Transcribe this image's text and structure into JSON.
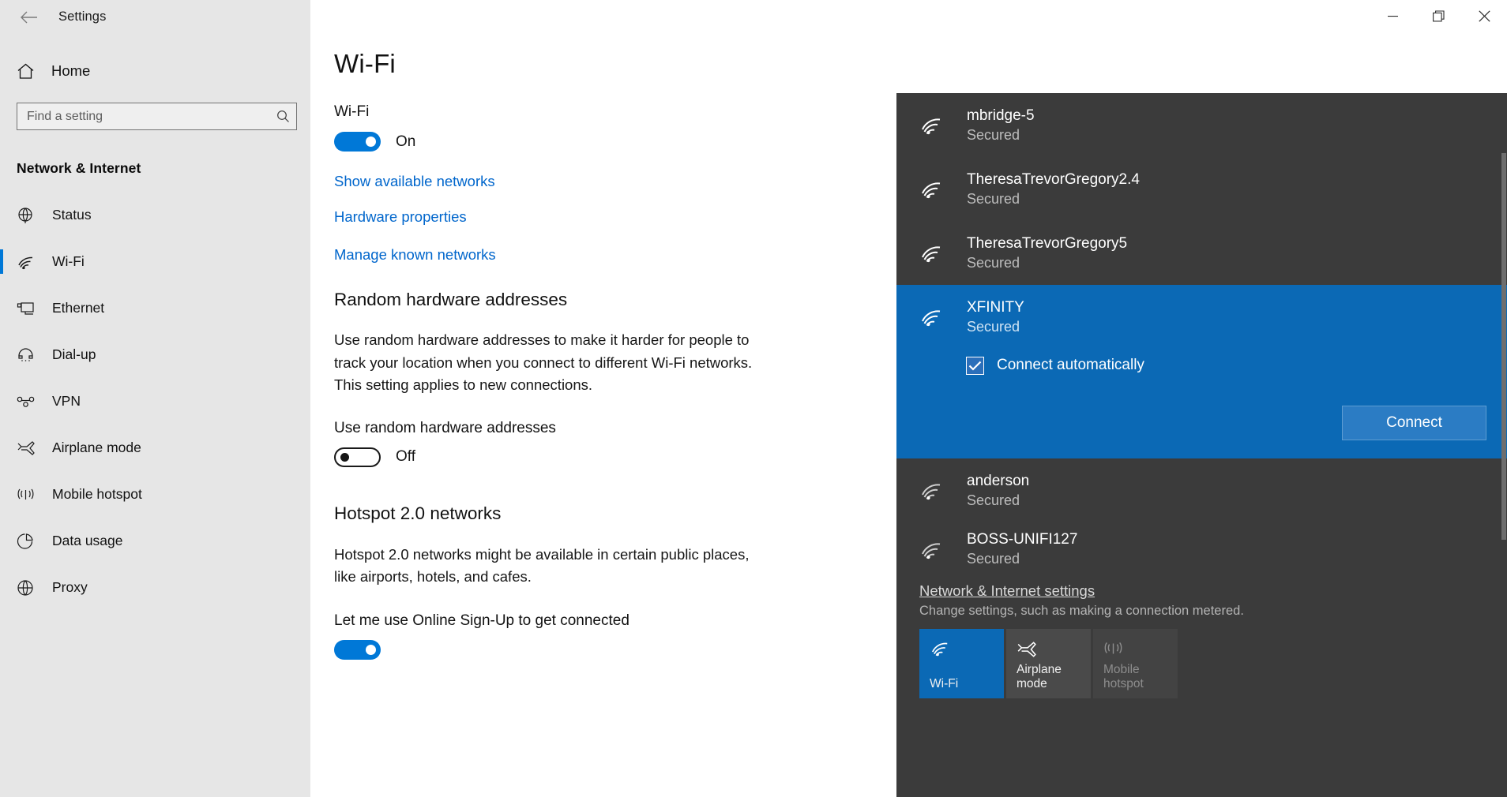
{
  "window": {
    "title": "Settings",
    "back_icon": "back-arrow-icon",
    "minimize_label": "Minimize",
    "restore_label": "Restore",
    "close_label": "Close"
  },
  "sidebar": {
    "home_label": "Home",
    "home_icon": "home-icon",
    "search": {
      "placeholder": "Find a setting",
      "value": "",
      "icon": "search-icon"
    },
    "category": "Network & Internet",
    "items": [
      {
        "label": "Status",
        "icon": "globe-icon",
        "active": false
      },
      {
        "label": "Wi-Fi",
        "icon": "wifi-icon",
        "active": true
      },
      {
        "label": "Ethernet",
        "icon": "ethernet-icon",
        "active": false
      },
      {
        "label": "Dial-up",
        "icon": "dialup-icon",
        "active": false
      },
      {
        "label": "VPN",
        "icon": "vpn-icon",
        "active": false
      },
      {
        "label": "Airplane mode",
        "icon": "airplane-icon",
        "active": false
      },
      {
        "label": "Mobile hotspot",
        "icon": "hotspot-icon",
        "active": false
      },
      {
        "label": "Data usage",
        "icon": "data-usage-icon",
        "active": false
      },
      {
        "label": "Proxy",
        "icon": "proxy-icon",
        "active": false
      }
    ]
  },
  "main": {
    "page_title": "Wi-Fi",
    "wifi_section": {
      "label": "Wi-Fi",
      "toggle_state": "On",
      "toggle_on": true
    },
    "links": [
      "Show available networks",
      "Hardware properties",
      "Manage known networks"
    ],
    "random_hw": {
      "heading": "Random hardware addresses",
      "description": "Use random hardware addresses to make it harder for people to track your location when you connect to different Wi-Fi networks. This setting applies to new connections.",
      "toggle_label": "Use random hardware addresses",
      "toggle_state": "Off",
      "toggle_on": false
    },
    "hotspot": {
      "heading": "Hotspot 2.0 networks",
      "description": "Hotspot 2.0 networks might be available in certain public places, like airports, hotels, and cafes.",
      "toggle_label": "Let me use Online Sign-Up to get connected"
    }
  },
  "flyout": {
    "networks": [
      {
        "name": "mbridge-5",
        "status": "Secured",
        "selected": false
      },
      {
        "name": "TheresaTrevorGregory2.4",
        "status": "Secured",
        "selected": false
      },
      {
        "name": "TheresaTrevorGregory5",
        "status": "Secured",
        "selected": false
      },
      {
        "name": "XFINITY",
        "status": "Secured",
        "selected": true
      },
      {
        "name": "anderson",
        "status": "Secured",
        "selected": false
      },
      {
        "name": "BOSS-UNIFI127",
        "status": "Secured",
        "selected": false
      }
    ],
    "selected_network": {
      "connect_automatically_label": "Connect automatically",
      "connect_automatically_checked": true,
      "connect_button": "Connect"
    },
    "footer": {
      "settings_link": "Network & Internet settings",
      "settings_desc": "Change settings, such as making a connection metered."
    },
    "tiles": [
      {
        "label": "Wi-Fi",
        "icon": "wifi-icon",
        "state": "on"
      },
      {
        "label": "Airplane mode",
        "icon": "airplane-icon",
        "state": "off"
      },
      {
        "label": "Mobile hotspot",
        "icon": "hotspot-icon",
        "state": "dim"
      }
    ]
  },
  "colors": {
    "accent": "#0078d7",
    "flyout_bg": "#3b3b3b",
    "flyout_selected": "#0b69b5",
    "sidebar_bg": "#e6e6e6",
    "link": "#0066cc"
  }
}
